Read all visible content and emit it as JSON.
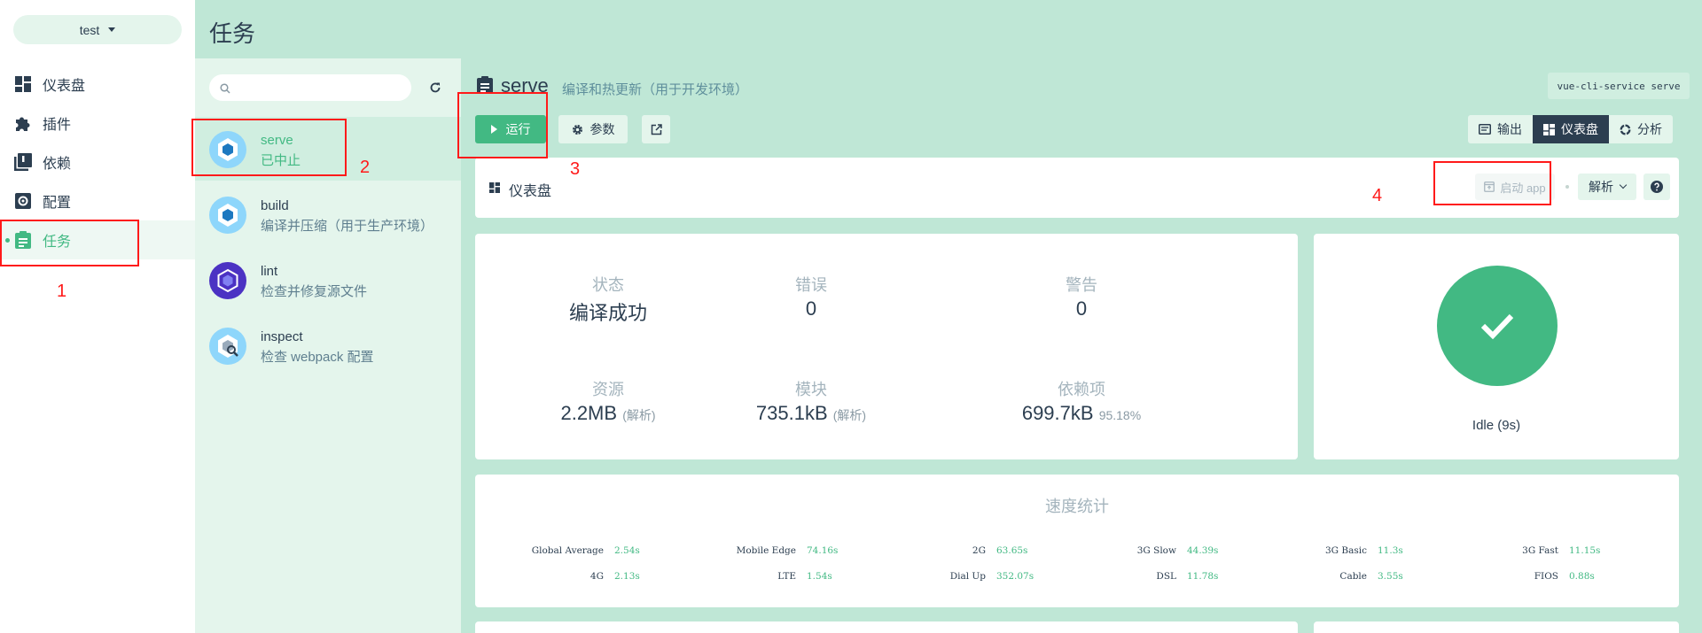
{
  "project": {
    "name": "test"
  },
  "nav": {
    "items": [
      {
        "label": "仪表盘",
        "icon": "dashboard-icon"
      },
      {
        "label": "插件",
        "icon": "puzzle-icon"
      },
      {
        "label": "依赖",
        "icon": "library-icon"
      },
      {
        "label": "配置",
        "icon": "settings-icon"
      },
      {
        "label": "任务",
        "icon": "clipboard-icon",
        "active": true
      }
    ]
  },
  "header": {
    "title": "任务"
  },
  "tasks": [
    {
      "name": "serve",
      "desc": "已中止",
      "selected": true
    },
    {
      "name": "build",
      "desc": "编译并压缩（用于生产环境）"
    },
    {
      "name": "lint",
      "desc": "检查并修复源文件"
    },
    {
      "name": "inspect",
      "desc": "检查 webpack 配置"
    }
  ],
  "task_detail": {
    "name": "serve",
    "description": "编译和热更新（用于开发环境）",
    "command": "vue-cli-service serve",
    "run_label": "运行",
    "params_label": "参数"
  },
  "view_tabs": [
    {
      "label": "输出",
      "icon": "terminal-icon"
    },
    {
      "label": "仪表盘",
      "icon": "dashboard-icon",
      "active": true
    },
    {
      "label": "分析",
      "icon": "donut-icon"
    }
  ],
  "dashboard": {
    "title": "仪表盘",
    "launch_label": "启动 app",
    "analyze_label": "解析"
  },
  "stats": {
    "status": {
      "label": "状态",
      "value": "编译成功"
    },
    "errors": {
      "label": "错误",
      "value": "0"
    },
    "warnings": {
      "label": "警告",
      "value": "0"
    },
    "assets": {
      "label": "资源",
      "value": "2.2MB",
      "extra": "(解析)"
    },
    "modules": {
      "label": "模块",
      "value": "735.1kB",
      "extra": "(解析)"
    },
    "deps": {
      "label": "依赖项",
      "value": "699.7kB",
      "extra": "95.18%"
    }
  },
  "status_card": {
    "text": "Idle (9s)"
  },
  "speed": {
    "title": "速度统计",
    "rows": [
      [
        {
          "name": "Global Average",
          "value": "2.54s"
        },
        {
          "name": "Mobile Edge",
          "value": "74.16s"
        },
        {
          "name": "2G",
          "value": "63.65s"
        },
        {
          "name": "3G Slow",
          "value": "44.39s"
        },
        {
          "name": "3G Basic",
          "value": "11.3s"
        },
        {
          "name": "3G Fast",
          "value": "11.15s"
        }
      ],
      [
        {
          "name": "4G",
          "value": "2.13s"
        },
        {
          "name": "LTE",
          "value": "1.54s"
        },
        {
          "name": "Dial Up",
          "value": "352.07s"
        },
        {
          "name": "DSL",
          "value": "11.78s"
        },
        {
          "name": "Cable",
          "value": "3.55s"
        },
        {
          "name": "FIOS",
          "value": "0.88s"
        }
      ]
    ]
  },
  "annotations": [
    "1",
    "2",
    "3",
    "4"
  ],
  "colors": {
    "accent": "#42b983",
    "header_bg": "#bfe7d6",
    "panel_bg": "#e4f5ec",
    "dark": "#2c3e50",
    "annotation": "#ff1a1a"
  }
}
